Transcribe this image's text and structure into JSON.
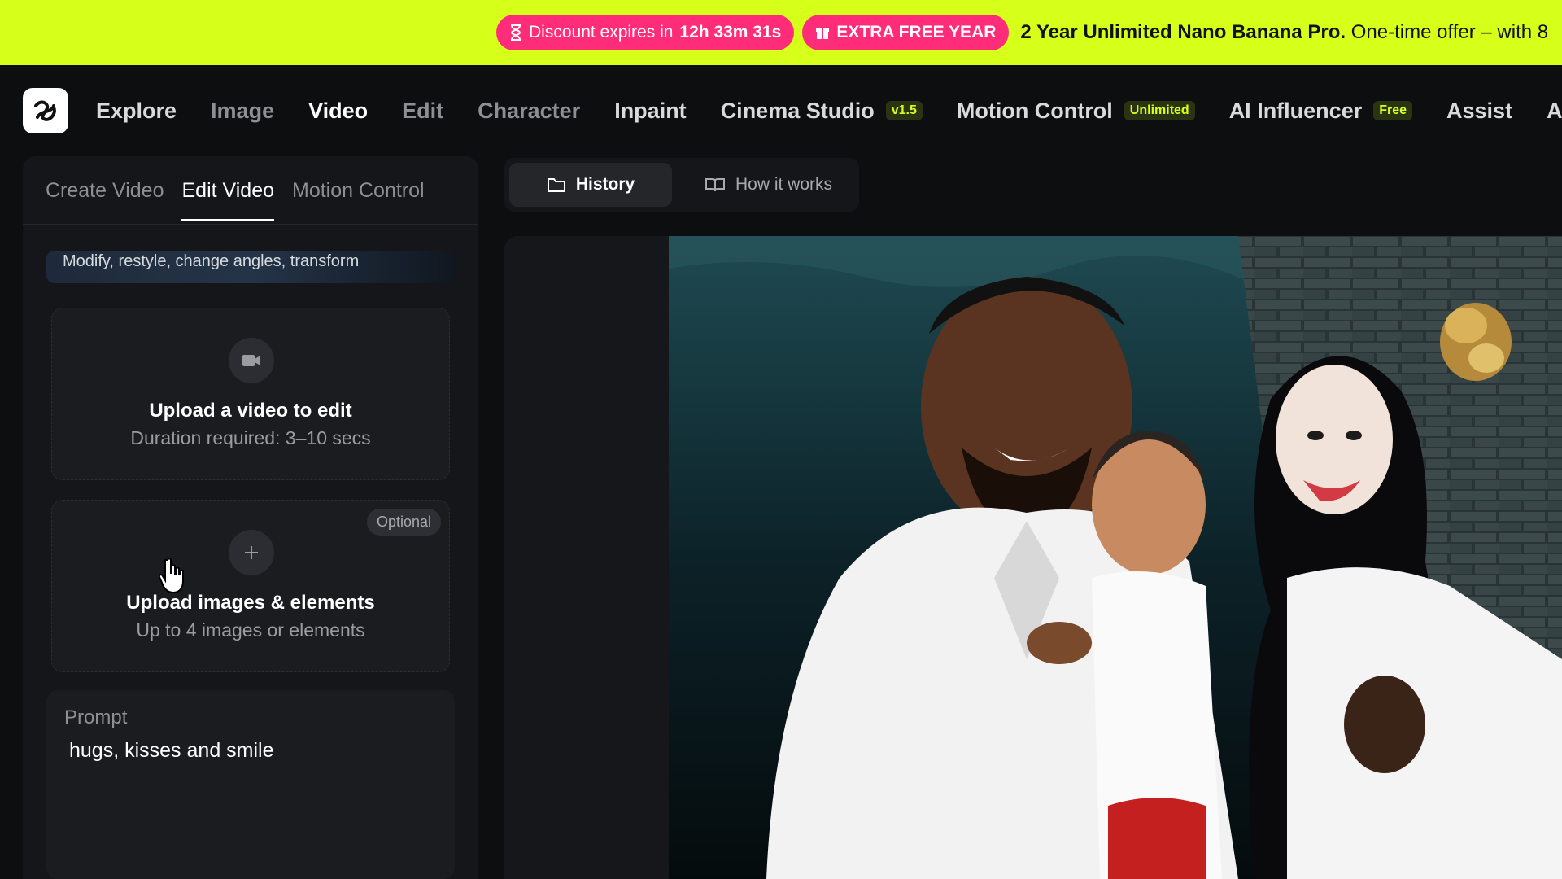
{
  "promo": {
    "countdown_prefix": "Discount expires in",
    "countdown_time": "12h 33m 31s",
    "extra_offer": "EXTRA FREE YEAR",
    "headline_bold": "2 Year Unlimited Nano Banana Pro.",
    "headline_rest": "One-time offer – with 8",
    "pill_color": "#ff2d79",
    "banner_color": "#d6ff1a"
  },
  "nav": {
    "items": [
      {
        "label": "Explore"
      },
      {
        "label": "Image"
      },
      {
        "label": "Video"
      },
      {
        "label": "Edit"
      },
      {
        "label": "Character"
      },
      {
        "label": "Inpaint"
      },
      {
        "label": "Cinema Studio",
        "badge": "v1.5"
      },
      {
        "label": "Motion Control",
        "badge": "Unlimited"
      },
      {
        "label": "AI Influencer",
        "badge": "Free"
      },
      {
        "label": "Assist"
      },
      {
        "label": "App"
      }
    ],
    "active": "Video"
  },
  "left_panel": {
    "tabs": [
      "Create Video",
      "Edit Video",
      "Motion Control"
    ],
    "active_tab": "Edit Video",
    "hint_text": "Modify, restyle, change angles, transform",
    "upload_video": {
      "title": "Upload a video to edit",
      "subtitle": "Duration required: 3–10 secs"
    },
    "upload_images": {
      "badge": "Optional",
      "title": "Upload images & elements",
      "subtitle": "Up to 4 images or elements"
    },
    "prompt": {
      "label": "Prompt",
      "value": "hugs, kisses and smile"
    }
  },
  "right_panel": {
    "history_label": "History",
    "how_label": "How it works"
  }
}
